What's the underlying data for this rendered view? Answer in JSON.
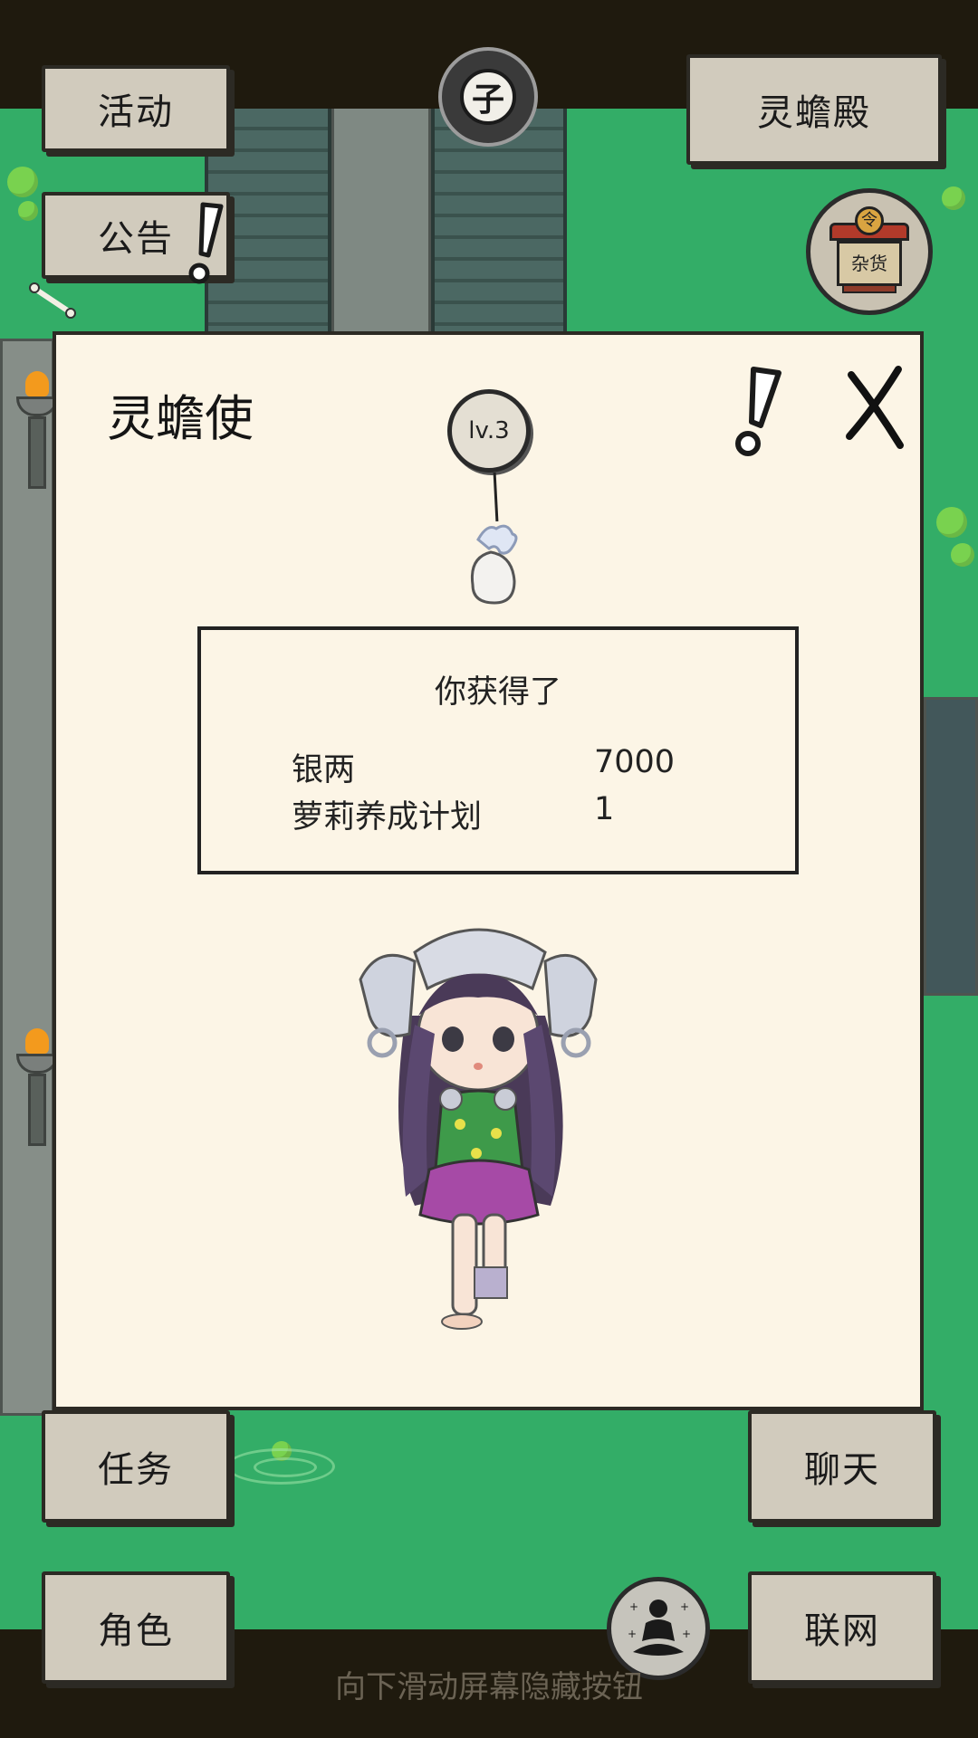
{
  "top": {
    "activity_label": "活动",
    "notice_label": "公告",
    "hall_label": "灵蟾殿",
    "time_symbol": "子",
    "shop_sign_top": "令",
    "shop_sign": "杂货"
  },
  "dialog": {
    "title": "灵蟾使",
    "level": "lv.3",
    "reward_heading": "你获得了",
    "rewards": [
      {
        "name": "银两",
        "qty": "7000"
      },
      {
        "name": "萝莉养成计划",
        "qty": "1"
      }
    ]
  },
  "bottom": {
    "task_label": "任务",
    "chat_label": "聊天",
    "role_label": "角色",
    "network_label": "联网",
    "hint": "向下滑动屏幕隐藏按钮"
  },
  "colors": {
    "grass": "#33ad67",
    "bar": "#1f1a0e",
    "button": "#d1cbbd",
    "dialog": "#fcf5e6"
  },
  "icons": [
    "exclamation-icon",
    "close-icon",
    "level-badge-icon",
    "pouch-icon",
    "time-dial-icon",
    "shop-icon",
    "meditate-icon",
    "bone-icon"
  ]
}
